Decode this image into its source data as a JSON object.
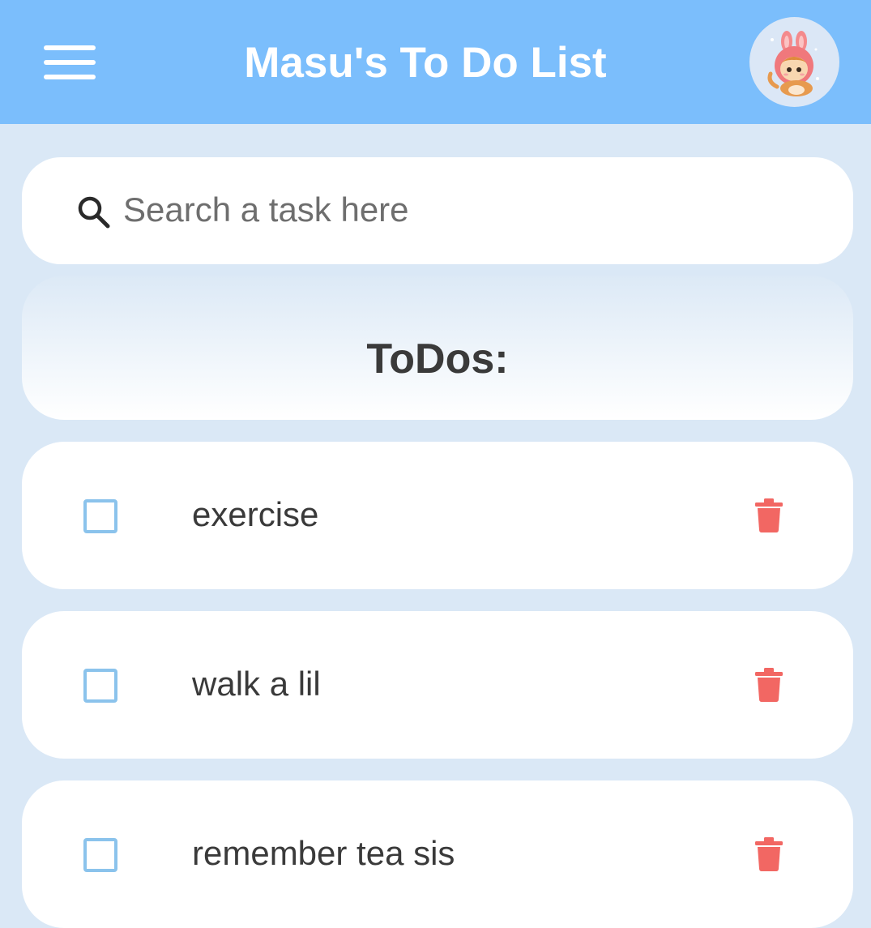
{
  "appbar": {
    "title": "Masu's To Do List",
    "menu_icon": "hamburger-menu-icon",
    "avatar_icon": "avatar-image"
  },
  "search": {
    "placeholder": "Search a task here",
    "value": "",
    "icon": "search-icon"
  },
  "todos": {
    "heading": "ToDos:",
    "items": [
      {
        "label": "exercise",
        "checked": false
      },
      {
        "label": "walk a lil",
        "checked": false
      },
      {
        "label": "remember tea sis",
        "checked": false
      }
    ]
  },
  "colors": {
    "appbar": "#7bbefc",
    "background": "#dae8f6",
    "checkbox": "#8bc3ec",
    "delete": "#f26763"
  }
}
